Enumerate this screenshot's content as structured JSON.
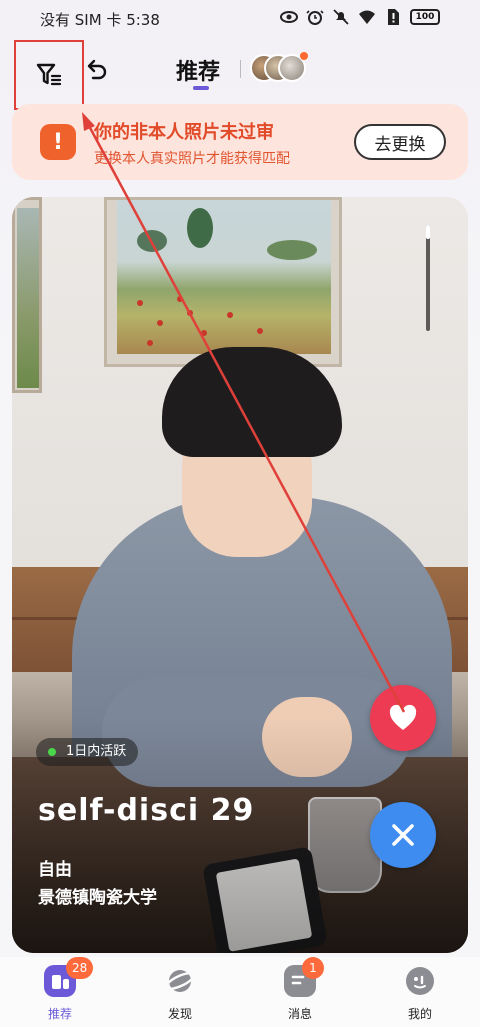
{
  "status_bar": {
    "carrier_time": "没有 SIM 卡 5:38",
    "battery": "100",
    "icons": [
      "eye-icon",
      "alarm-icon",
      "mute-icon",
      "wifi-icon",
      "no-sim-icon",
      "battery-icon"
    ]
  },
  "header": {
    "filter_icon": "filter-icon",
    "undo_icon": "undo-icon",
    "tab_title": "推荐",
    "accent_color": "#6b59d8"
  },
  "banner": {
    "icon": "!",
    "title": "你的非本人照片未过审",
    "subtitle": "更换本人真实照片才能获得匹配",
    "button": "去更换",
    "accent_color": "#f0622c"
  },
  "card": {
    "active_badge": "1日内活跃",
    "name_age": "self-disci 29",
    "status": "自由",
    "school": "景德镇陶瓷大学"
  },
  "actions": {
    "like_icon": "heart-icon",
    "dislike_icon": "close-icon",
    "like_color": "#ec3b53",
    "dislike_color": "#3e8cf0"
  },
  "bottom_nav": {
    "items": [
      {
        "label": "推荐",
        "icon": "recommend-icon",
        "badge": "28",
        "active": true
      },
      {
        "label": "发现",
        "icon": "planet-icon",
        "badge": "",
        "active": false
      },
      {
        "label": "消息",
        "icon": "message-icon",
        "badge": "1",
        "active": false
      },
      {
        "label": "我的",
        "icon": "profile-icon",
        "badge": "",
        "active": false
      }
    ]
  }
}
